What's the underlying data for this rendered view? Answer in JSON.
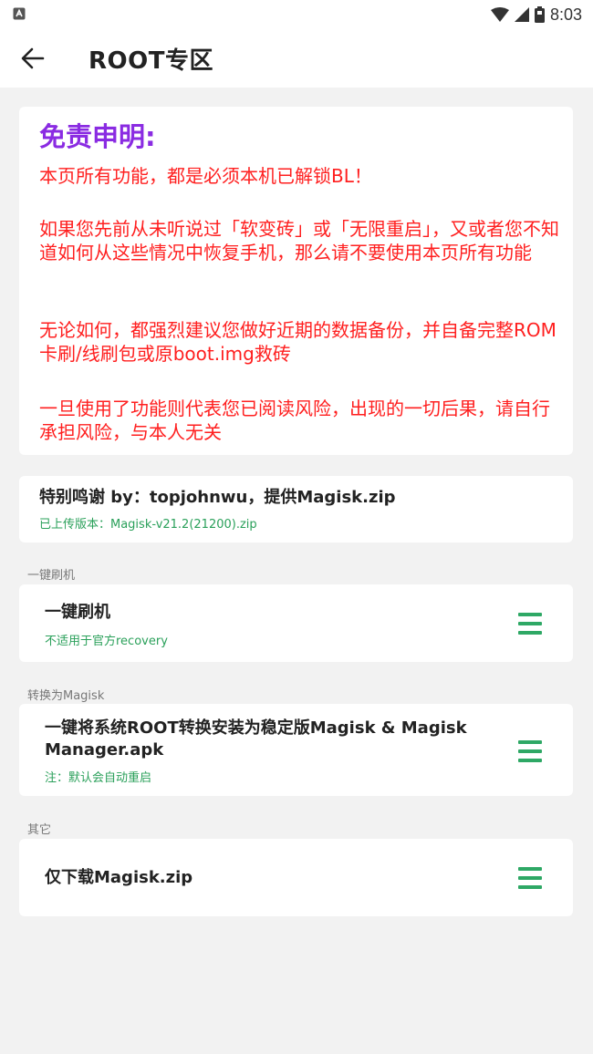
{
  "status_bar": {
    "time": "8:03"
  },
  "app_bar": {
    "title": "ROOT专区",
    "back_icon": "arrow-left-icon"
  },
  "disclaimer": {
    "heading": "免责申明:",
    "paragraphs": [
      "本页所有功能，都是必须本机已解锁BL！",
      "如果您先前从未听说过「软变砖」或「无限重启」，又或者您不知道如何从这些情况中恢复手机，那么请不要使用本页所有功能",
      "无论如何，都强烈建议您做好近期的数据备份，并自备完整ROM卡刷/线刷包或原boot.img救砖",
      "一旦使用了功能则代表您已阅读风险，出现的一切后果，请自行承担风险，与本人无关"
    ]
  },
  "thanks": {
    "title": "特别鸣谢 by：topjohnwu，提供Magisk.zip",
    "version": "已上传版本：Magisk-v21.2(21200).zip"
  },
  "sections": [
    {
      "label": "一键刷机",
      "title": "一键刷机",
      "subtitle": "不适用于官方recovery",
      "icon": "menu-icon"
    },
    {
      "label": "转换为Magisk",
      "title": "一键将系统ROOT转换安装为稳定版Magisk & Magisk Manager.apk",
      "subtitle": "注：默认会自动重启",
      "icon": "menu-icon"
    },
    {
      "label": "其它",
      "title": "仅下载Magisk.zip",
      "subtitle": "",
      "icon": "menu-icon"
    }
  ],
  "colors": {
    "heading_purple": "#8a2be2",
    "warning_red": "#ff1f1f",
    "accent_green": "#2ea865",
    "background": "#f2f2f2"
  }
}
